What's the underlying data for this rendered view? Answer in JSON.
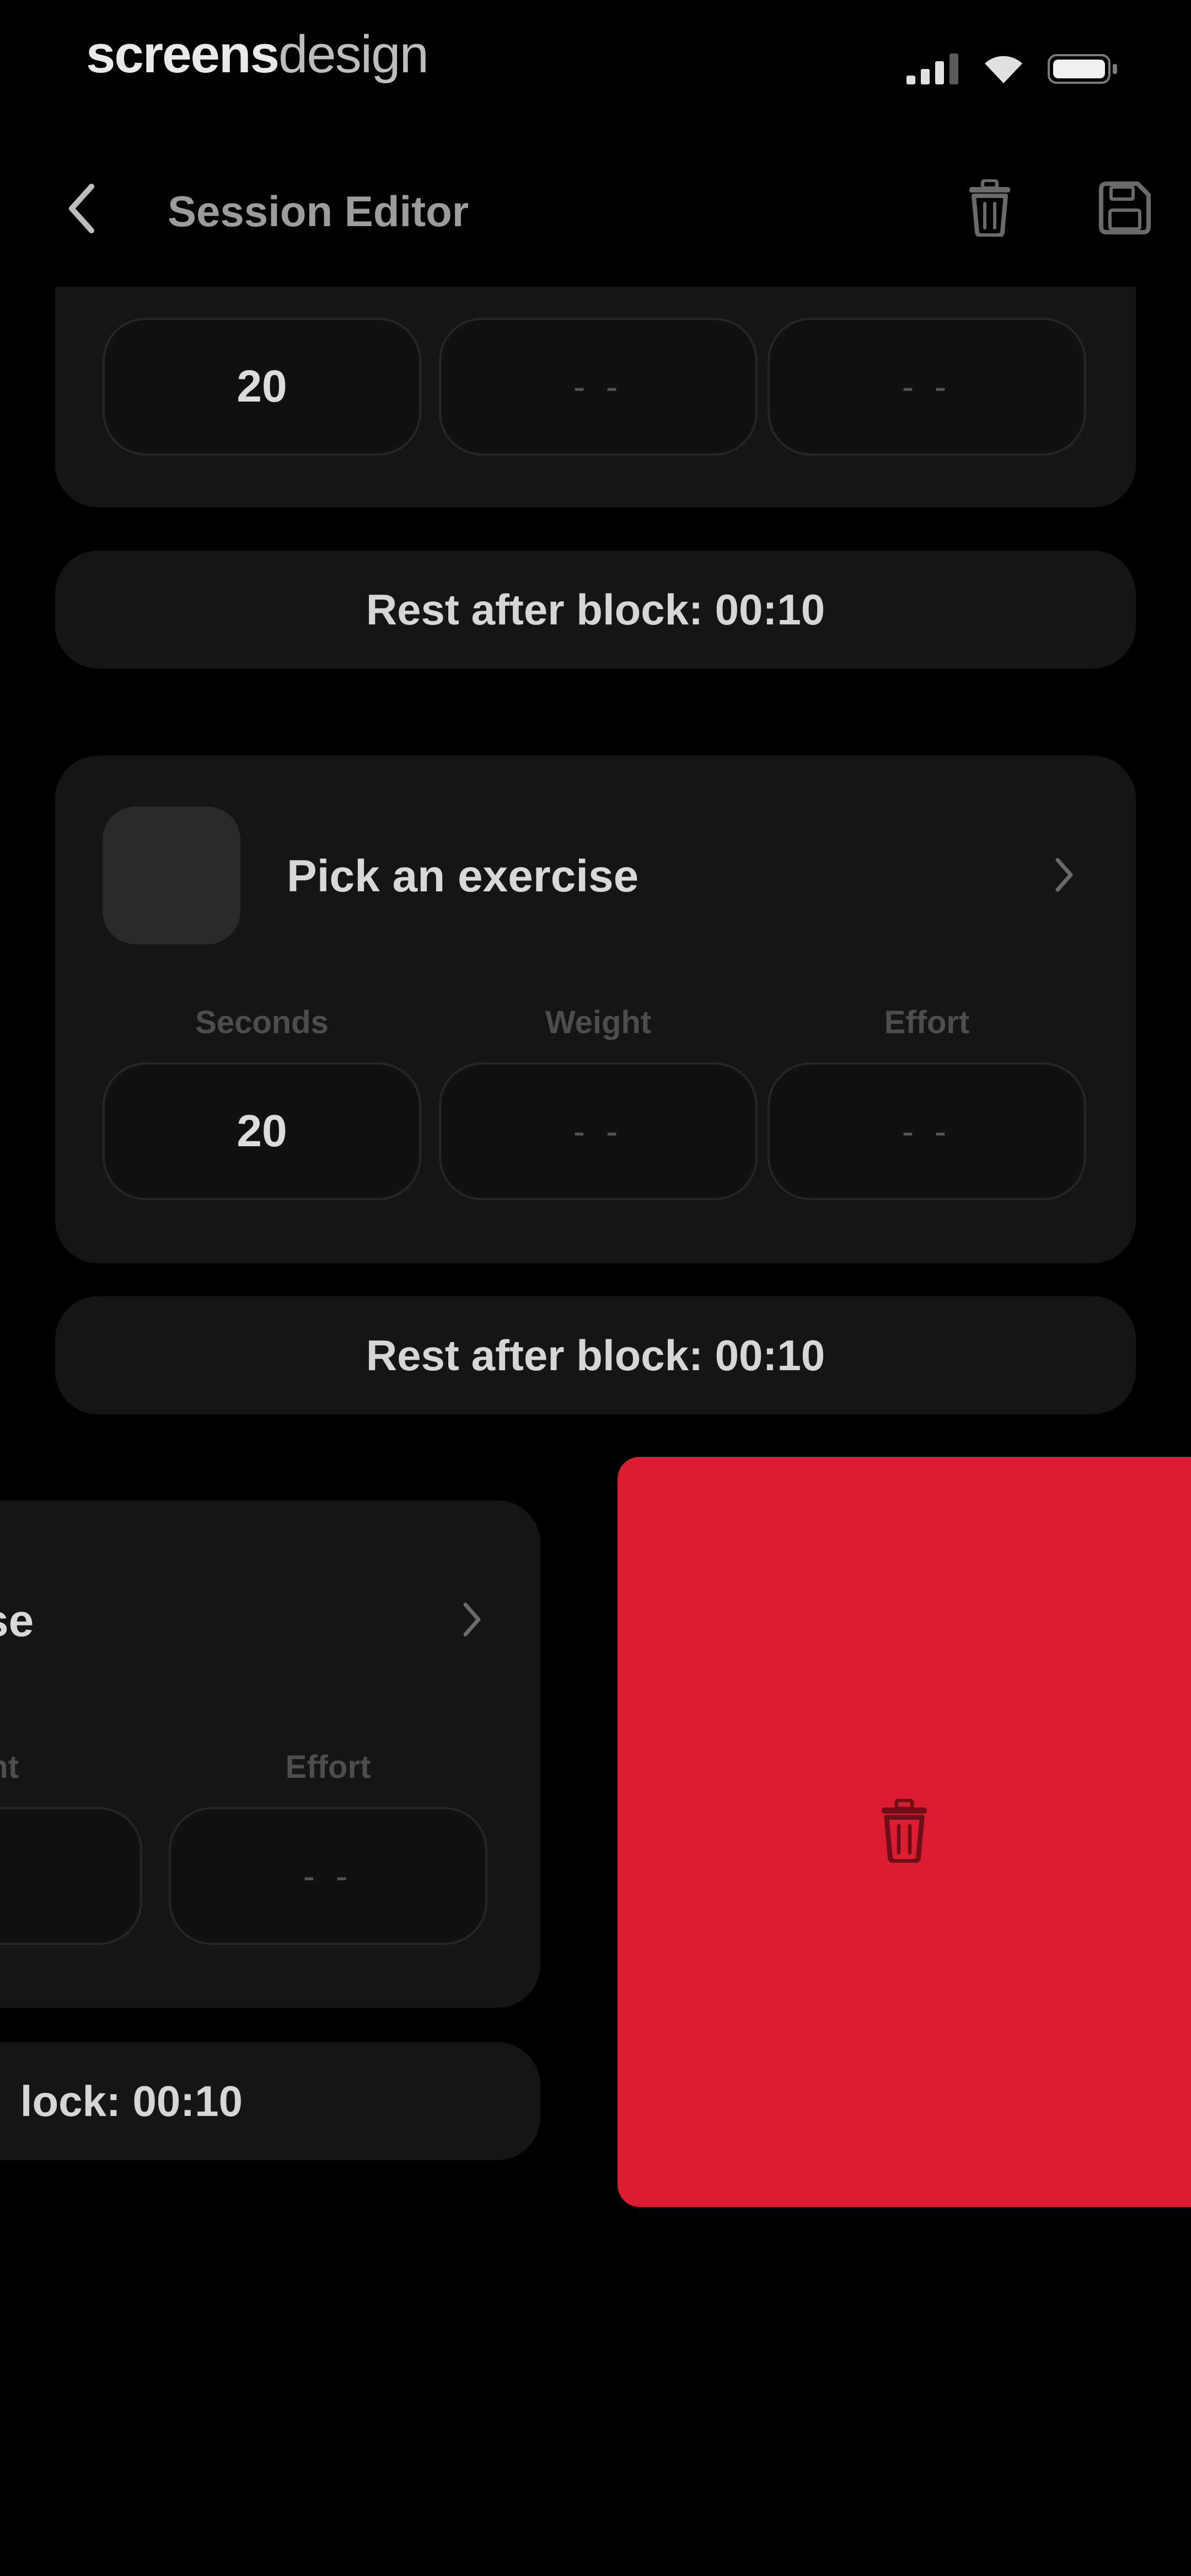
{
  "status_bar": {
    "brand_bold": "screens",
    "brand_light": "design",
    "icons": [
      "cellular-signal-icon",
      "wifi-icon",
      "battery-icon"
    ]
  },
  "nav": {
    "title": "Session Editor",
    "icons": [
      "back-chevron-icon",
      "trash-icon",
      "save-icon"
    ]
  },
  "blocks": [
    {
      "seconds_value": "20",
      "weight_value": "- -",
      "effort_value": "- -",
      "rest_label": "Rest after block: 00:10"
    },
    {
      "exercise_label": "Pick an exercise",
      "seconds_label": "Seconds",
      "weight_label": "Weight",
      "effort_label": "Effort",
      "seconds_value": "20",
      "weight_value": "- -",
      "effort_value": "- -",
      "rest_label": "Rest after block: 00:10"
    },
    {
      "exercise_label": "se",
      "weight_label": "ght",
      "effort_label": "Effort",
      "weight_value": "-",
      "effort_value": "- -",
      "rest_label": "lock: 00:10"
    }
  ],
  "colors": {
    "background": "#000000",
    "card": "#151515",
    "delete_accent": "#dc1c30"
  }
}
